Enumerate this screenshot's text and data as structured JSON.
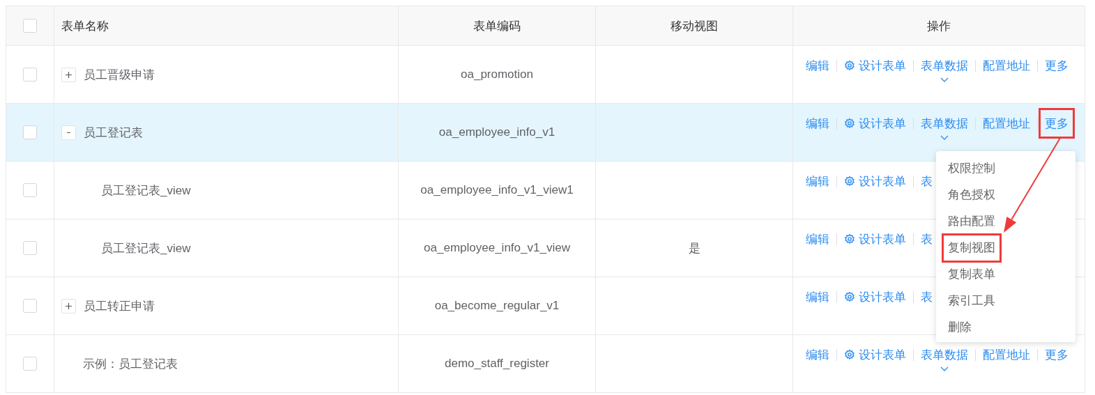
{
  "table": {
    "header_checkbox": {
      "checked": false
    },
    "columns": [
      "表单名称",
      "表单编码",
      "移动视图",
      "操作"
    ],
    "rows": [
      {
        "checked": false,
        "selected": false,
        "name": "员工晋级申请",
        "code": "oa_promotion",
        "expanded": false,
        "actions": [
          {
            "label": "编辑",
            "kind": "link",
            "highlight": false
          },
          {
            "label": "设计表单",
            "kind": "design",
            "highlight": false
          },
          {
            "label": "表单数据",
            "kind": "data",
            "highlight": false
          },
          {
            "label": "配置地址",
            "kind": "link",
            "highlight": false
          },
          {
            "label": "更多",
            "kind": "link",
            "highlight": false
          }
        ]
      },
      {
        "checked": false,
        "selected": true,
        "name": "员工登记表",
        "code": "oa_employee_info_v1",
        "expanded": true,
        "actions": [
          {
            "label": "编辑",
            "kind": "link",
            "highlight": false
          },
          {
            "label": "设计表单",
            "kind": "design",
            "highlight": false
          },
          {
            "label": "表单数据",
            "kind": "data",
            "highlight": false
          },
          {
            "label": "配置地址",
            "kind": "link",
            "highlight": false
          },
          {
            "label": "更多",
            "kind": "link",
            "highlight": true
          }
        ],
        "children": [
          {
            "checked": false,
            "selected": false,
            "name": "员工登记表_view",
            "code": "oa_employee_info_v1_view1",
            "actions": [
              {
                "label": "编辑",
                "kind": "link",
                "highlight": false
              },
              {
                "label": "设计表单",
                "kind": "design",
                "highlight": false
              },
              {
                "label": "表",
                "kind": "link",
                "highlight": false
              }
            ]
          },
          {
            "checked": false,
            "selected": false,
            "name": "员工登记表_view",
            "code": "oa_employee_info_v1_view",
            "mobile": "是",
            "actions": [
              {
                "label": "编辑",
                "kind": "link",
                "highlight": false
              },
              {
                "label": "设计表单",
                "kind": "design",
                "highlight": false
              },
              {
                "label": "表",
                "kind": "link",
                "highlight": false
              }
            ]
          }
        ]
      },
      {
        "checked": false,
        "selected": false,
        "name": "员工转正申请",
        "code": "oa_become_regular_v1",
        "expanded": false,
        "actions": [
          {
            "label": "编辑",
            "kind": "link",
            "highlight": false
          },
          {
            "label": "设计表单",
            "kind": "design",
            "highlight": false
          },
          {
            "label": "表",
            "kind": "link",
            "highlight": false
          }
        ]
      },
      {
        "checked": false,
        "selected": false,
        "name": "示例：员工登记表",
        "code": "demo_staff_register",
        "actions": [
          {
            "label": "编辑",
            "kind": "link",
            "highlight": false
          },
          {
            "label": "设计表单",
            "kind": "design",
            "highlight": false
          },
          {
            "label": "表单数据",
            "kind": "data",
            "highlight": false
          },
          {
            "label": "配置地址",
            "kind": "link",
            "highlight": false
          },
          {
            "label": "更多",
            "kind": "link",
            "highlight": false
          }
        ]
      }
    ]
  },
  "dropdown_menu": {
    "items": [
      {
        "label": "权限控制",
        "highlight": false
      },
      {
        "label": "角色授权",
        "highlight": false
      },
      {
        "label": "路由配置",
        "highlight": false
      },
      {
        "label": "复制视图",
        "highlight": true
      },
      {
        "label": "复制表单",
        "highlight": false
      },
      {
        "label": "索引工具",
        "highlight": false
      },
      {
        "label": "删除",
        "highlight": false
      }
    ]
  },
  "annotation_arrow": true
}
